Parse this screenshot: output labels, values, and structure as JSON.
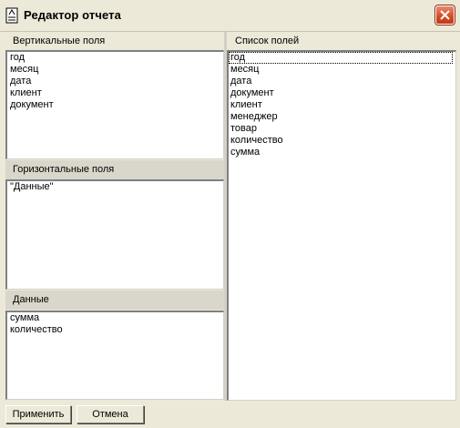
{
  "window": {
    "title": "Редактор отчета",
    "close_icon": "close-x-icon",
    "title_icon": "report-editor-icon",
    "close_color": "#d24a24"
  },
  "vertical": {
    "header": "Вертикальные поля",
    "items": [
      "год",
      "месяц",
      "дата",
      "клиент",
      "документ"
    ]
  },
  "horizontal": {
    "header": "Горизонтальные поля",
    "items": [
      "\"Данные\""
    ]
  },
  "data_section": {
    "header": "Данные",
    "items": [
      "сумма",
      "количество"
    ]
  },
  "fields": {
    "header": "Список полей",
    "items": [
      "год",
      "месяц",
      "дата",
      "документ",
      "клиент",
      "менеджер",
      "товар",
      "количество",
      "сумма"
    ]
  },
  "buttons": {
    "apply": "Применить",
    "cancel": "Отмена"
  }
}
